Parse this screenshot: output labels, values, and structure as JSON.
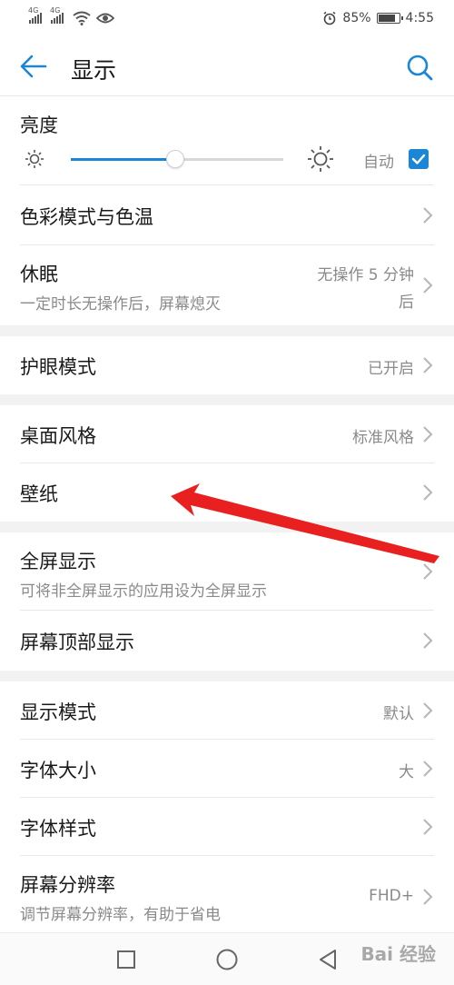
{
  "status_bar": {
    "signal1_label": "4G",
    "signal2_label": "4G",
    "battery_percent_text": "85%",
    "battery_level": 0.85,
    "time": "4:55",
    "icons": [
      "signal-icon",
      "wifi-icon",
      "eye-comfort-icon",
      "alarm-icon",
      "battery-icon"
    ]
  },
  "header": {
    "title": "显示"
  },
  "brightness": {
    "label": "亮度",
    "level": 0.49,
    "auto_label": "自动",
    "auto_checked": true
  },
  "rows": {
    "color_mode": {
      "label": "色彩模式与色温"
    },
    "sleep": {
      "label": "休眠",
      "subtitle": "一定时长无操作后，屏幕熄灭",
      "value_line1": "无操作 5 分钟",
      "value_line2": "后"
    },
    "eye_comfort": {
      "label": "护眼模式",
      "value": "已开启"
    },
    "home_style": {
      "label": "桌面风格",
      "value": "标准风格"
    },
    "wallpaper": {
      "label": "壁纸"
    },
    "full_screen": {
      "label": "全屏显示",
      "subtitle": "可将非全屏显示的应用设为全屏显示"
    },
    "notch": {
      "label": "屏幕顶部显示"
    },
    "display_mode": {
      "label": "显示模式",
      "value": "默认"
    },
    "font_size": {
      "label": "字体大小",
      "value": "大"
    },
    "font_style": {
      "label": "字体样式"
    },
    "resolution": {
      "label": "屏幕分辨率",
      "subtitle": "调节屏幕分辨率，有助于省电",
      "value": "FHD+"
    }
  },
  "annotation": {
    "color": "#e8201f",
    "points_to": "wallpaper"
  },
  "colors": {
    "accent": "#1b86d6",
    "section_gap": "#f2f2f2"
  },
  "watermark": "Bai 经验"
}
